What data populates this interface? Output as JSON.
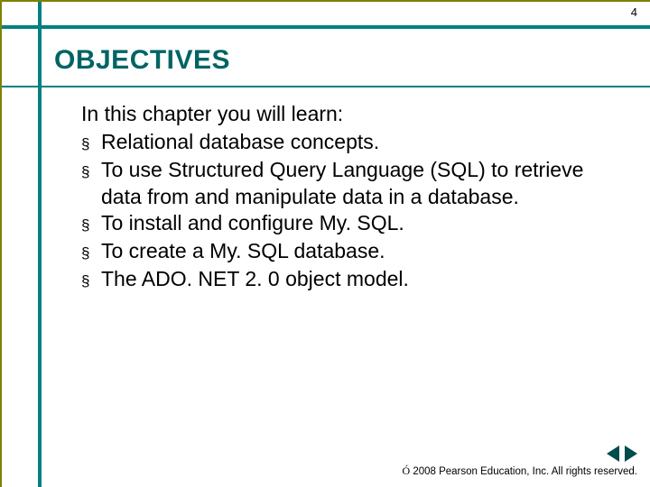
{
  "page_number": "4",
  "title": "OBJECTIVES",
  "intro": "In this chapter you will learn:",
  "bullet_char": "§",
  "bullets": [
    "Relational database concepts.",
    "To use Structured Query Language (SQL) to retrieve data from and manipulate data in a database.",
    "To install and configure My. SQL.",
    "To create a My. SQL database.",
    "The ADO. NET 2. 0 object model."
  ],
  "copyright_symbol": "Ó",
  "copyright_text": " 2008 Pearson Education, Inc.  All rights reserved."
}
